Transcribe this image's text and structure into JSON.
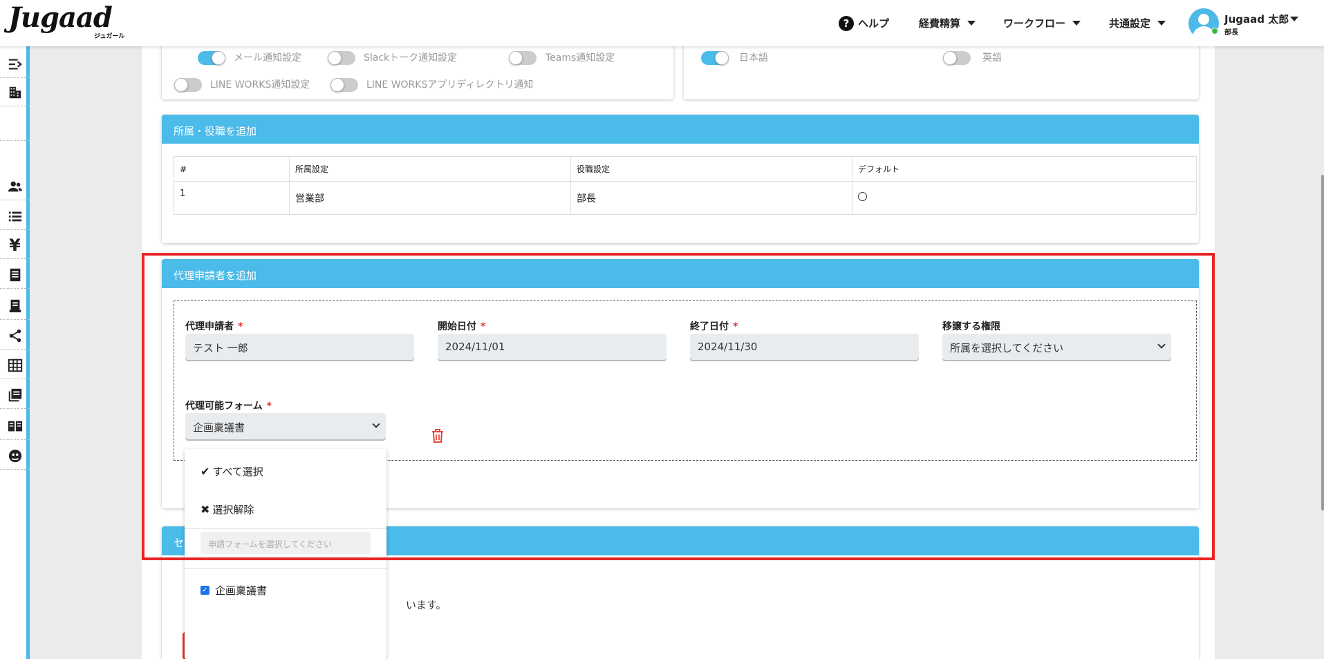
{
  "header": {
    "logo_text": "Jugaad",
    "logo_sub": "ジュガール",
    "nav": {
      "help": "ヘルプ",
      "expense": "経費精算",
      "workflow": "ワークフロー",
      "common": "共通設定"
    },
    "user": {
      "name": "Jugaad 太郎",
      "role": "部長"
    }
  },
  "notifications": {
    "toggles": [
      {
        "label": "メール通知設定",
        "on": true
      },
      {
        "label": "Slackトーク通知設定",
        "on": false
      },
      {
        "label": "Teams通知設定",
        "on": false
      },
      {
        "label": "LINE WORKS通知設定",
        "on": false
      },
      {
        "label": "LINE WORKSアプリディレクトリ通知",
        "on": false
      }
    ]
  },
  "language": {
    "options": [
      {
        "label": "日本語",
        "on": true
      },
      {
        "label": "英語",
        "on": false
      }
    ]
  },
  "affiliation": {
    "title": "所属・役職を追加",
    "headers": [
      "#",
      "所属設定",
      "役職設定",
      "デフォルト"
    ],
    "rows": [
      {
        "num": "1",
        "dept": "営業部",
        "position": "部長"
      }
    ]
  },
  "proxy": {
    "title": "代理申請者を追加",
    "applicant_label": "代理申請者",
    "applicant_value": "テスト 一郎",
    "start_label": "開始日付",
    "start_value": "2024/11/01",
    "end_label": "終了日付",
    "end_value": "2024/11/30",
    "authority_label": "移譲する権限",
    "authority_value": "所属を選択してください",
    "forms_label": "代理可能フォーム",
    "forms_value": "企画稟議書",
    "required_mark": "*"
  },
  "dropdown": {
    "select_all": "すべて選択",
    "deselect": "選択解除",
    "search_placeholder": "申請フォームを選択してください",
    "options": [
      {
        "label": "企画稟議書",
        "checked": true
      }
    ]
  },
  "next_section": {
    "title_partial": "セ",
    "text_partial": "います。"
  },
  "colors": {
    "accent": "#4bbbe9",
    "highlight": "#e82525",
    "required": "#e3342f",
    "trash": "#e3342f"
  }
}
